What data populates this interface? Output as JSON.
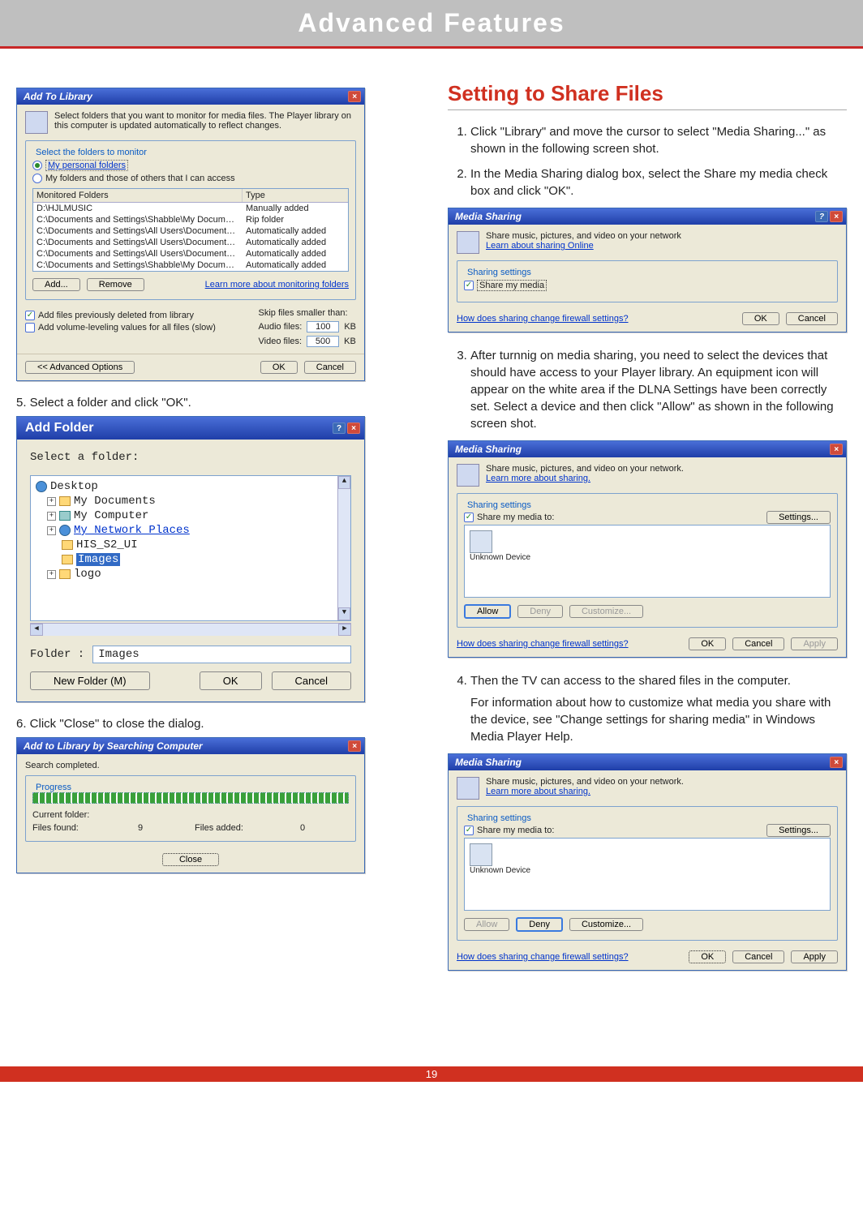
{
  "banner": "Advanced Features",
  "page_number": "19",
  "left": {
    "step5": "5. Select a folder and click \"OK\".",
    "step6": "6. Click \"Close\" to close the dialog."
  },
  "add_to_library": {
    "title": "Add To Library",
    "desc": "Select folders that you want to monitor for media files. The Player library on this computer is updated automatically to reflect changes.",
    "legend": "Select the folders to monitor",
    "radio1": "My personal folders",
    "radio2": "My folders and those of others that I can access",
    "col_folders": "Monitored Folders",
    "col_type": "Type",
    "rows": [
      {
        "path": "D:\\HJLMUSIC",
        "type": "Manually added"
      },
      {
        "path": "C:\\Documents and Settings\\Shabble\\My Documents\\My Music",
        "type": "Rip folder"
      },
      {
        "path": "C:\\Documents and Settings\\All Users\\Documents\\My Music",
        "type": "Automatically added"
      },
      {
        "path": "C:\\Documents and Settings\\All Users\\Documents\\My Pictures",
        "type": "Automatically added"
      },
      {
        "path": "C:\\Documents and Settings\\All Users\\Documents\\My Videos",
        "type": "Automatically added"
      },
      {
        "path": "C:\\Documents and Settings\\Shabble\\My Documents\\My Pict...",
        "type": "Automatically added"
      }
    ],
    "btn_add": "Add...",
    "btn_remove": "Remove",
    "learn_link": "Learn more about monitoring folders",
    "chk_prev": "Add files previously deleted from library",
    "chk_vol": "Add volume-leveling values for all files (slow)",
    "skip_label": "Skip files smaller than:",
    "audio_label": "Audio files:",
    "audio_val": "100",
    "video_label": "Video files:",
    "video_val": "500",
    "kb": "KB",
    "adv": "<< Advanced Options",
    "ok": "OK",
    "cancel": "Cancel"
  },
  "add_folder": {
    "title": "Add Folder",
    "prompt": "Select a folder:",
    "items": {
      "desktop": "Desktop",
      "mydocs": "My Documents",
      "mycomp": "My Computer",
      "mynet": "My Network Places",
      "his": "HIS_S2_UI",
      "images": "Images",
      "logo": "logo"
    },
    "folder_label": "Folder :",
    "folder_value": "Images",
    "new_folder": "New Folder (M)",
    "ok": "OK",
    "cancel": "Cancel"
  },
  "search_dialog": {
    "title": "Add to Library by Searching Computer",
    "done": "Search completed.",
    "legend": "Progress",
    "current_folder_lbl": "Current folder:",
    "files_found_lbl": "Files found:",
    "files_found_val": "9",
    "files_added_lbl": "Files added:",
    "files_added_val": "0",
    "close": "Close"
  },
  "right": {
    "section_title": "Setting to Share Files",
    "step1": "Click \"Library\" and move the cursor to select \"Media Sharing...\" as shown in the following screen shot.",
    "step2": "In the Media Sharing dialog box, select the Share my media check box and click \"OK\".",
    "step3": "After turnnig on media sharing, you need to select the devices that should have access to your Player library. An equipment icon will appear on the white area if the DLNA Settings have been correctly set. Select a device and then click \"Allow\" as shown in the following screen shot.",
    "step4": "Then the TV can access to the shared files in the computer.",
    "step4b": "For information about how to customize what media you share with the device, see \"Change settings for sharing media\" in Windows Media Player Help."
  },
  "media_sharing_1": {
    "title": "Media Sharing",
    "desc": "Share music, pictures, and video on your network",
    "learn": "Learn about sharing Online",
    "legend": "Sharing settings",
    "chk": "Share my media",
    "fw": "How does sharing change firewall settings?",
    "ok": "OK",
    "cancel": "Cancel"
  },
  "media_sharing_2": {
    "title": "Media Sharing",
    "desc": "Share music, pictures, and video on your network.",
    "learn": "Learn more about sharing.",
    "legend": "Sharing settings",
    "chk": "Share my media to:",
    "settings": "Settings...",
    "device": "Unknown Device",
    "allow": "Allow",
    "deny": "Deny",
    "customize": "Customize...",
    "fw": "How does sharing change firewall settings?",
    "ok": "OK",
    "cancel": "Cancel",
    "apply": "Apply"
  },
  "media_sharing_3": {
    "title": "Media Sharing",
    "desc": "Share music, pictures, and video on your network.",
    "learn": "Learn more about sharing.",
    "legend": "Sharing settings",
    "chk": "Share my media to:",
    "settings": "Settings...",
    "device": "Unknown Device",
    "allow": "Allow",
    "deny": "Deny",
    "customize": "Customize...",
    "fw": "How does sharing change firewall settings?",
    "ok": "OK",
    "cancel": "Cancel",
    "apply": "Apply"
  }
}
